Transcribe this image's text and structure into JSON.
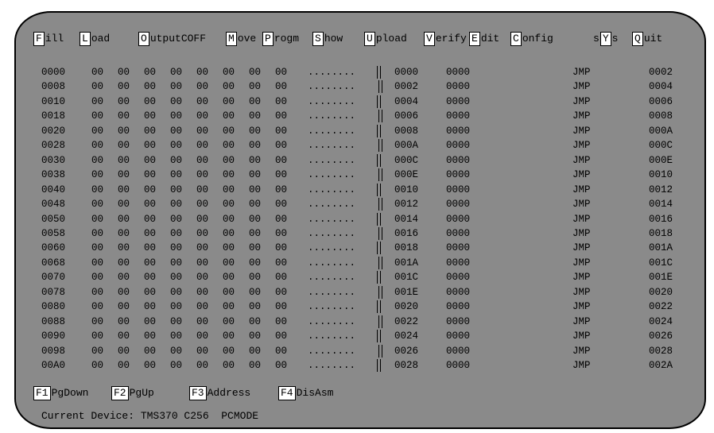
{
  "menu": [
    {
      "key": "F",
      "rest": "ill"
    },
    {
      "key": "L",
      "rest": "oad"
    },
    {
      "key": "O",
      "rest": "utputCOFF"
    },
    {
      "key": "M",
      "rest": "ove"
    },
    {
      "key": "P",
      "rest": "rogm"
    },
    {
      "key": "S",
      "rest": "how"
    },
    {
      "key": "U",
      "rest": "pload"
    },
    {
      "key": "V",
      "rest": "erify"
    },
    {
      "key": "E",
      "rest": "dit"
    },
    {
      "key": "C",
      "rest": "onfig"
    },
    {
      "pre": "s",
      "key": "Y",
      "rest": "s"
    },
    {
      "key": "Q",
      "rest": "uit"
    }
  ],
  "memory_rows": [
    {
      "addr": "0000",
      "bytes": [
        "00",
        "00",
        "00",
        "00",
        "00",
        "00",
        "00",
        "00"
      ],
      "ascii": "........"
    },
    {
      "addr": "0008",
      "bytes": [
        "00",
        "00",
        "00",
        "00",
        "00",
        "00",
        "00",
        "00"
      ],
      "ascii": "........"
    },
    {
      "addr": "0010",
      "bytes": [
        "00",
        "00",
        "00",
        "00",
        "00",
        "00",
        "00",
        "00"
      ],
      "ascii": "........"
    },
    {
      "addr": "0018",
      "bytes": [
        "00",
        "00",
        "00",
        "00",
        "00",
        "00",
        "00",
        "00"
      ],
      "ascii": "........"
    },
    {
      "addr": "0020",
      "bytes": [
        "00",
        "00",
        "00",
        "00",
        "00",
        "00",
        "00",
        "00"
      ],
      "ascii": "........"
    },
    {
      "addr": "0028",
      "bytes": [
        "00",
        "00",
        "00",
        "00",
        "00",
        "00",
        "00",
        "00"
      ],
      "ascii": "........"
    },
    {
      "addr": "0030",
      "bytes": [
        "00",
        "00",
        "00",
        "00",
        "00",
        "00",
        "00",
        "00"
      ],
      "ascii": "........"
    },
    {
      "addr": "0038",
      "bytes": [
        "00",
        "00",
        "00",
        "00",
        "00",
        "00",
        "00",
        "00"
      ],
      "ascii": "........"
    },
    {
      "addr": "0040",
      "bytes": [
        "00",
        "00",
        "00",
        "00",
        "00",
        "00",
        "00",
        "00"
      ],
      "ascii": "........"
    },
    {
      "addr": "0048",
      "bytes": [
        "00",
        "00",
        "00",
        "00",
        "00",
        "00",
        "00",
        "00"
      ],
      "ascii": "........"
    },
    {
      "addr": "0050",
      "bytes": [
        "00",
        "00",
        "00",
        "00",
        "00",
        "00",
        "00",
        "00"
      ],
      "ascii": "........"
    },
    {
      "addr": "0058",
      "bytes": [
        "00",
        "00",
        "00",
        "00",
        "00",
        "00",
        "00",
        "00"
      ],
      "ascii": "........"
    },
    {
      "addr": "0060",
      "bytes": [
        "00",
        "00",
        "00",
        "00",
        "00",
        "00",
        "00",
        "00"
      ],
      "ascii": "........"
    },
    {
      "addr": "0068",
      "bytes": [
        "00",
        "00",
        "00",
        "00",
        "00",
        "00",
        "00",
        "00"
      ],
      "ascii": "........"
    },
    {
      "addr": "0070",
      "bytes": [
        "00",
        "00",
        "00",
        "00",
        "00",
        "00",
        "00",
        "00"
      ],
      "ascii": "........"
    },
    {
      "addr": "0078",
      "bytes": [
        "00",
        "00",
        "00",
        "00",
        "00",
        "00",
        "00",
        "00"
      ],
      "ascii": "........"
    },
    {
      "addr": "0080",
      "bytes": [
        "00",
        "00",
        "00",
        "00",
        "00",
        "00",
        "00",
        "00"
      ],
      "ascii": "........"
    },
    {
      "addr": "0088",
      "bytes": [
        "00",
        "00",
        "00",
        "00",
        "00",
        "00",
        "00",
        "00"
      ],
      "ascii": "........"
    },
    {
      "addr": "0090",
      "bytes": [
        "00",
        "00",
        "00",
        "00",
        "00",
        "00",
        "00",
        "00"
      ],
      "ascii": "........"
    },
    {
      "addr": "0098",
      "bytes": [
        "00",
        "00",
        "00",
        "00",
        "00",
        "00",
        "00",
        "00"
      ],
      "ascii": "........"
    },
    {
      "addr": "00A0",
      "bytes": [
        "00",
        "00",
        "00",
        "00",
        "00",
        "00",
        "00",
        "00"
      ],
      "ascii": "........"
    }
  ],
  "disasm_rows": [
    {
      "addr": "0000",
      "word": "0000",
      "mnemonic": "JMP",
      "target": "0002"
    },
    {
      "addr": "0002",
      "word": "0000",
      "mnemonic": "JMP",
      "target": "0004"
    },
    {
      "addr": "0004",
      "word": "0000",
      "mnemonic": "JMP",
      "target": "0006"
    },
    {
      "addr": "0006",
      "word": "0000",
      "mnemonic": "JMP",
      "target": "0008"
    },
    {
      "addr": "0008",
      "word": "0000",
      "mnemonic": "JMP",
      "target": "000A"
    },
    {
      "addr": "000A",
      "word": "0000",
      "mnemonic": "JMP",
      "target": "000C"
    },
    {
      "addr": "000C",
      "word": "0000",
      "mnemonic": "JMP",
      "target": "000E"
    },
    {
      "addr": "000E",
      "word": "0000",
      "mnemonic": "JMP",
      "target": "0010"
    },
    {
      "addr": "0010",
      "word": "0000",
      "mnemonic": "JMP",
      "target": "0012"
    },
    {
      "addr": "0012",
      "word": "0000",
      "mnemonic": "JMP",
      "target": "0014"
    },
    {
      "addr": "0014",
      "word": "0000",
      "mnemonic": "JMP",
      "target": "0016"
    },
    {
      "addr": "0016",
      "word": "0000",
      "mnemonic": "JMP",
      "target": "0018"
    },
    {
      "addr": "0018",
      "word": "0000",
      "mnemonic": "JMP",
      "target": "001A"
    },
    {
      "addr": "001A",
      "word": "0000",
      "mnemonic": "JMP",
      "target": "001C"
    },
    {
      "addr": "001C",
      "word": "0000",
      "mnemonic": "JMP",
      "target": "001E"
    },
    {
      "addr": "001E",
      "word": "0000",
      "mnemonic": "JMP",
      "target": "0020"
    },
    {
      "addr": "0020",
      "word": "0000",
      "mnemonic": "JMP",
      "target": "0022"
    },
    {
      "addr": "0022",
      "word": "0000",
      "mnemonic": "JMP",
      "target": "0024"
    },
    {
      "addr": "0024",
      "word": "0000",
      "mnemonic": "JMP",
      "target": "0026"
    },
    {
      "addr": "0026",
      "word": "0000",
      "mnemonic": "JMP",
      "target": "0028"
    },
    {
      "addr": "0028",
      "word": "0000",
      "mnemonic": "JMP",
      "target": "002A"
    }
  ],
  "function_keys": [
    {
      "key": "F1",
      "label": "PgDown"
    },
    {
      "key": "F2",
      "label": "PgUp"
    },
    {
      "key": "F3",
      "label": "Address"
    },
    {
      "key": "F4",
      "label": "DisAsm"
    }
  ],
  "status": {
    "text": "Current Device: TMS370 C256  PCMODE"
  },
  "colors": {
    "screen_bg": "#8a8a8a",
    "hotkey_bg": "#ffffff"
  }
}
